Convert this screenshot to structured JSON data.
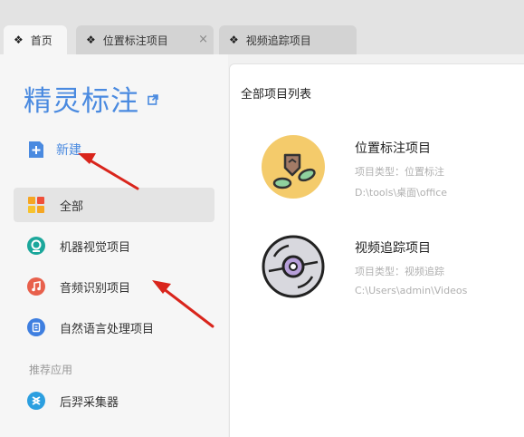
{
  "tabs": [
    {
      "label": "首页",
      "active": true
    },
    {
      "label": "位置标注项目",
      "active": false,
      "close": "×"
    },
    {
      "label": "视频追踪项目",
      "active": false
    }
  ],
  "sidebar": {
    "brand": "精灵标注",
    "new_label": "新建",
    "nav": [
      {
        "label": "全部",
        "icon": "all-grid-icon",
        "active": true
      },
      {
        "label": "机器视觉项目",
        "icon": "vision-icon"
      },
      {
        "label": "音频识别项目",
        "icon": "music-note-icon"
      },
      {
        "label": "自然语言处理项目",
        "icon": "document-icon"
      }
    ],
    "section_label": "推荐应用",
    "apps": [
      {
        "label": "后羿采集器",
        "icon": "collector-icon"
      }
    ]
  },
  "main": {
    "title": "全部项目列表",
    "projects": [
      {
        "name": "位置标注项目",
        "type": "项目类型：位置标注",
        "path": "D:\\tools\\桌面\\office",
        "icon": "location-label-icon"
      },
      {
        "name": "视频追踪项目",
        "type": "项目类型：视频追踪",
        "path": "C:\\Users\\admin\\Videos",
        "icon": "video-disc-icon"
      }
    ]
  },
  "colors": {
    "accent": "#4a8ae0",
    "annotation_arrow": "#d9251c"
  }
}
